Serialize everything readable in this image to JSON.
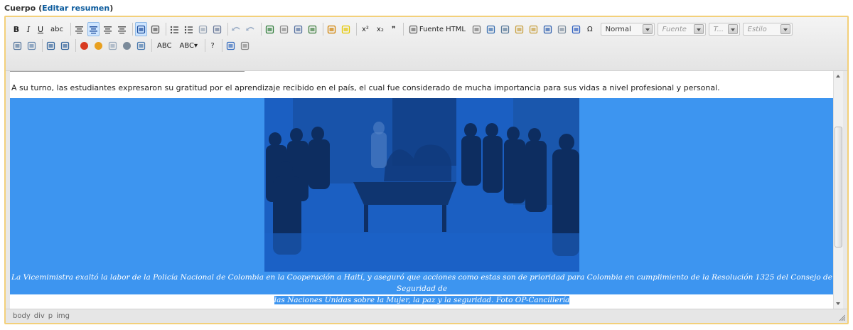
{
  "field": {
    "label": "Cuerpo",
    "link": "Editar resumen"
  },
  "toolbar": {
    "row1": [
      {
        "name": "bold-button",
        "label": "B",
        "cls": "b"
      },
      {
        "name": "italic-button",
        "label": "I",
        "cls": "i"
      },
      {
        "name": "underline-button",
        "label": "U",
        "cls": "u"
      },
      {
        "name": "strikethrough-button",
        "label": "abc",
        "cls": "txt"
      },
      {
        "name": "align-left-button",
        "icon": "align-left-icon"
      },
      {
        "name": "align-center-button",
        "icon": "align-center-icon",
        "active": true
      },
      {
        "name": "align-right-button",
        "icon": "align-right-icon"
      },
      {
        "name": "justify-button",
        "icon": "justify-icon"
      },
      {
        "name": "ltr-button",
        "icon": "ltr-icon",
        "active": true
      },
      {
        "name": "rtl-button",
        "icon": "rtl-icon"
      },
      {
        "name": "bulleted-list-button",
        "icon": "bulleted-list-icon"
      },
      {
        "name": "numbered-list-button",
        "icon": "numbered-list-icon"
      },
      {
        "name": "outdent-button",
        "icon": "outdent-icon"
      },
      {
        "name": "indent-button",
        "icon": "indent-icon"
      },
      {
        "name": "undo-button",
        "icon": "undo-icon"
      },
      {
        "name": "redo-button",
        "icon": "redo-icon"
      },
      {
        "name": "link-button",
        "icon": "link-icon"
      },
      {
        "name": "unlink-button",
        "icon": "unlink-icon"
      },
      {
        "name": "anchor-button",
        "icon": "anchor-icon"
      },
      {
        "name": "image-button",
        "icon": "image-icon"
      },
      {
        "name": "text-color-button",
        "icon": "text-color-icon"
      },
      {
        "name": "bg-color-button",
        "icon": "bg-color-icon"
      },
      {
        "name": "superscript-button",
        "label": "x²",
        "cls": "txt"
      },
      {
        "name": "subscript-button",
        "label": "x₂",
        "cls": "txt"
      },
      {
        "name": "blockquote-button",
        "label": "❞",
        "cls": "txt"
      },
      {
        "name": "source-button",
        "label": "Fuente HTML",
        "cls": "txt",
        "icon": "source-icon"
      },
      {
        "name": "horizontal-rule-button",
        "icon": "horizontal-rule-icon"
      },
      {
        "name": "cut-button",
        "icon": "cut-icon"
      },
      {
        "name": "copy-button",
        "icon": "copy-icon"
      },
      {
        "name": "paste-button",
        "icon": "paste-icon"
      },
      {
        "name": "paste-text-button",
        "icon": "paste-text-icon"
      },
      {
        "name": "paste-word-button",
        "icon": "paste-word-icon"
      },
      {
        "name": "show-blocks-button",
        "icon": "show-blocks-icon"
      },
      {
        "name": "remove-format-button",
        "icon": "remove-format-icon"
      },
      {
        "name": "special-char-button",
        "label": "Ω",
        "cls": "txt"
      }
    ],
    "combos": [
      {
        "name": "format-select",
        "value": "Normal",
        "placeholder": false
      },
      {
        "name": "font-select",
        "value": "Fuente",
        "placeholder": true
      },
      {
        "name": "size-select",
        "value": "T...",
        "placeholder": true
      },
      {
        "name": "style-select",
        "value": "Estilo",
        "placeholder": true
      }
    ],
    "row2": [
      {
        "name": "table-button",
        "icon": "table-icon"
      },
      {
        "name": "select-all-button",
        "icon": "select-all-icon"
      },
      {
        "name": "find-button",
        "icon": "find-icon"
      },
      {
        "name": "replace-button",
        "icon": "replace-icon"
      },
      {
        "name": "flash-button",
        "icon": "flash-icon"
      },
      {
        "name": "smiley-button",
        "icon": "smiley-icon"
      },
      {
        "name": "iframe-button",
        "icon": "iframe-icon"
      },
      {
        "name": "media-button",
        "icon": "media-icon"
      },
      {
        "name": "page-break-button",
        "icon": "page-break-icon"
      },
      {
        "name": "spellcheck-button",
        "label": "ABC",
        "cls": "txt"
      },
      {
        "name": "scayt-button",
        "label": "ABC▾",
        "cls": "txt"
      },
      {
        "name": "about-button",
        "label": "?",
        "cls": "txt"
      },
      {
        "name": "maximize-button",
        "icon": "maximize-icon"
      },
      {
        "name": "templates-button",
        "icon": "templates-icon"
      }
    ]
  },
  "icon_colors": {
    "align-left-icon": "#555555",
    "align-center-icon": "#1f4f9e",
    "align-right-icon": "#555555",
    "justify-icon": "#555555",
    "ltr-icon": "#1f4f9e",
    "rtl-icon": "#555555",
    "bulleted-list-icon": "#4a4a4a",
    "numbered-list-icon": "#4a4a4a",
    "outdent-icon": "#9aa6b6",
    "indent-icon": "#6a7a9a",
    "undo-icon": "#9fb0c8",
    "redo-icon": "#9fb0c8",
    "link-icon": "#2f7d3a",
    "unlink-icon": "#8a8a8a",
    "anchor-icon": "#5470a0",
    "image-icon": "#3f7e3f",
    "text-color-icon": "#d08000",
    "bg-color-icon": "#e5c800",
    "source-icon": "#666666",
    "horizontal-rule-icon": "#777777",
    "cut-icon": "#3a6fb0",
    "copy-icon": "#5a7a9a",
    "paste-icon": "#c8a040",
    "paste-text-icon": "#c8a040",
    "paste-word-icon": "#2f5fae",
    "show-blocks-icon": "#7f8f9f",
    "remove-format-icon": "#3060c0",
    "table-icon": "#5a7aa0",
    "select-all-icon": "#6a8ab0",
    "find-icon": "#3a6aa0",
    "replace-icon": "#3a6aa0",
    "flash-icon": "#d83a20",
    "smiley-icon": "#e8a020",
    "iframe-icon": "#9aaabc",
    "media-icon": "#7a8a9a",
    "page-break-icon": "#4a7ab0",
    "maximize-icon": "#3a6fc0",
    "templates-icon": "#8a8a8a"
  },
  "content": {
    "paragraph": "A su turno, las estudiantes expresaron su gratitud por el aprendizaje recibido en el país, el cual fue considerado de mucha importancia para sus vidas a nivel profesional y personal.",
    "caption_line1": "La Vicemimistra exaltó la labor de la Policía Nacional de Colombia en la Cooperación a Haití, y aseguró que acciones como estas son de prioridad para Colombia en cumplimiento de la Resolución 1325 del Consejo de Seguridad de",
    "caption_line2": "las Naciones Unidas sobre la Mujer, la paz y la seguridad. Foto OP-Cancillería"
  },
  "colors": {
    "selection": "#3d95f0",
    "photo_tint": "#1b5fc2",
    "border_focus": "#f3d07a",
    "link": "#0a5a9c"
  },
  "statusbar": {
    "path": [
      "body",
      "div",
      "p",
      "img"
    ]
  }
}
